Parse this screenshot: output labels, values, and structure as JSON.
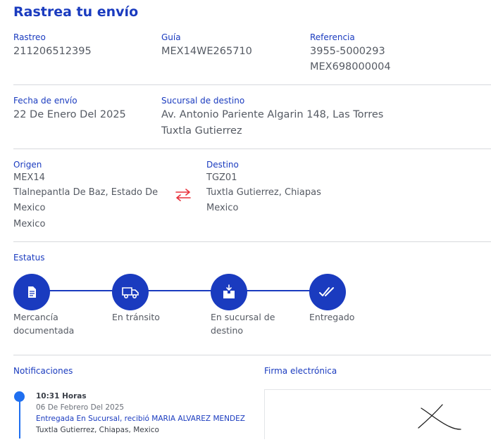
{
  "header": {
    "title": "Rastrea tu envío"
  },
  "row1": {
    "rastreo_label": "Rastreo",
    "rastreo_value": "211206512395",
    "guia_label": "Guía",
    "guia_value": "MEX14WE265710",
    "referencia_label": "Referencia",
    "referencia_line1": "3955-5000293",
    "referencia_line2": "MEX698000004"
  },
  "row2": {
    "fecha_label": "Fecha de envío",
    "fecha_value": "22 De Enero Del 2025",
    "sucursal_label": "Sucursal de destino",
    "sucursal_line1": "Av. Antonio Pariente Algarin 148, Las Torres",
    "sucursal_line2": "Tuxtla Gutierrez"
  },
  "route": {
    "origen_label": "Origen",
    "origen_code": "MEX14",
    "origen_line1": "Tlalnepantla De Baz, Estado De",
    "origen_line2": "Mexico",
    "origen_line3": "Mexico",
    "destino_label": "Destino",
    "destino_code": "TGZ01",
    "destino_line1": "Tuxtla Gutierrez, Chiapas",
    "destino_line2": "Mexico",
    "arrow_icon": "swap-arrows-icon",
    "arrow_color": "#e8323c"
  },
  "status": {
    "label": "Estatus",
    "steps": [
      {
        "line1": "Mercancía",
        "line2": "documentada",
        "icon": "document-icon"
      },
      {
        "line1": "En tránsito",
        "line2": "",
        "icon": "truck-icon"
      },
      {
        "line1": "En sucursal de",
        "line2": "destino",
        "icon": "package-icon"
      },
      {
        "line1": "Entregado",
        "line2": "",
        "icon": "double-check-icon"
      }
    ]
  },
  "notifications": {
    "label": "Notificaciones",
    "items": [
      {
        "time": "10:31 Horas",
        "date": "06 De Febrero Del 2025",
        "status": "Entregada En Sucursal, recibió MARIA ALVAREZ MENDEZ",
        "place": "Tuxtla Gutierrez, Chiapas, Mexico"
      }
    ]
  },
  "signature": {
    "label": "Firma electrónica"
  },
  "colors": {
    "accent": "#1a3bbf",
    "text": "#555a63",
    "divider": "#d7d9dd",
    "timeline": "#1f6ff0"
  }
}
